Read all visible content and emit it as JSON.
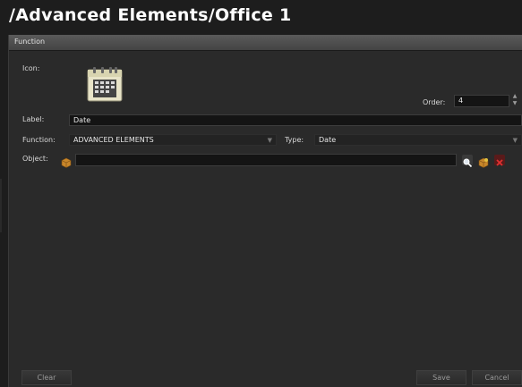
{
  "title": "/Advanced Elements/Office 1",
  "panel": {
    "header": "Function"
  },
  "icon": {
    "label": "Icon:",
    "name": "calendar-icon"
  },
  "order": {
    "label": "Order:",
    "value": "4"
  },
  "label_field": {
    "label": "Label:",
    "value": "Date"
  },
  "function_field": {
    "label": "Function:",
    "value": "ADVANCED ELEMENTS"
  },
  "type_field": {
    "label": "Type:",
    "value": "Date"
  },
  "object_field": {
    "label": "Object:",
    "value": ""
  },
  "buttons": {
    "clear": "Clear",
    "save": "Save",
    "cancel": "Cancel"
  },
  "colors": {
    "background": "#1d1d1d",
    "panel": "#2a2a2a",
    "field": "#141414",
    "text": "#d8d8d8",
    "accent_box": "#c8862a",
    "close_red": "#b02020"
  }
}
